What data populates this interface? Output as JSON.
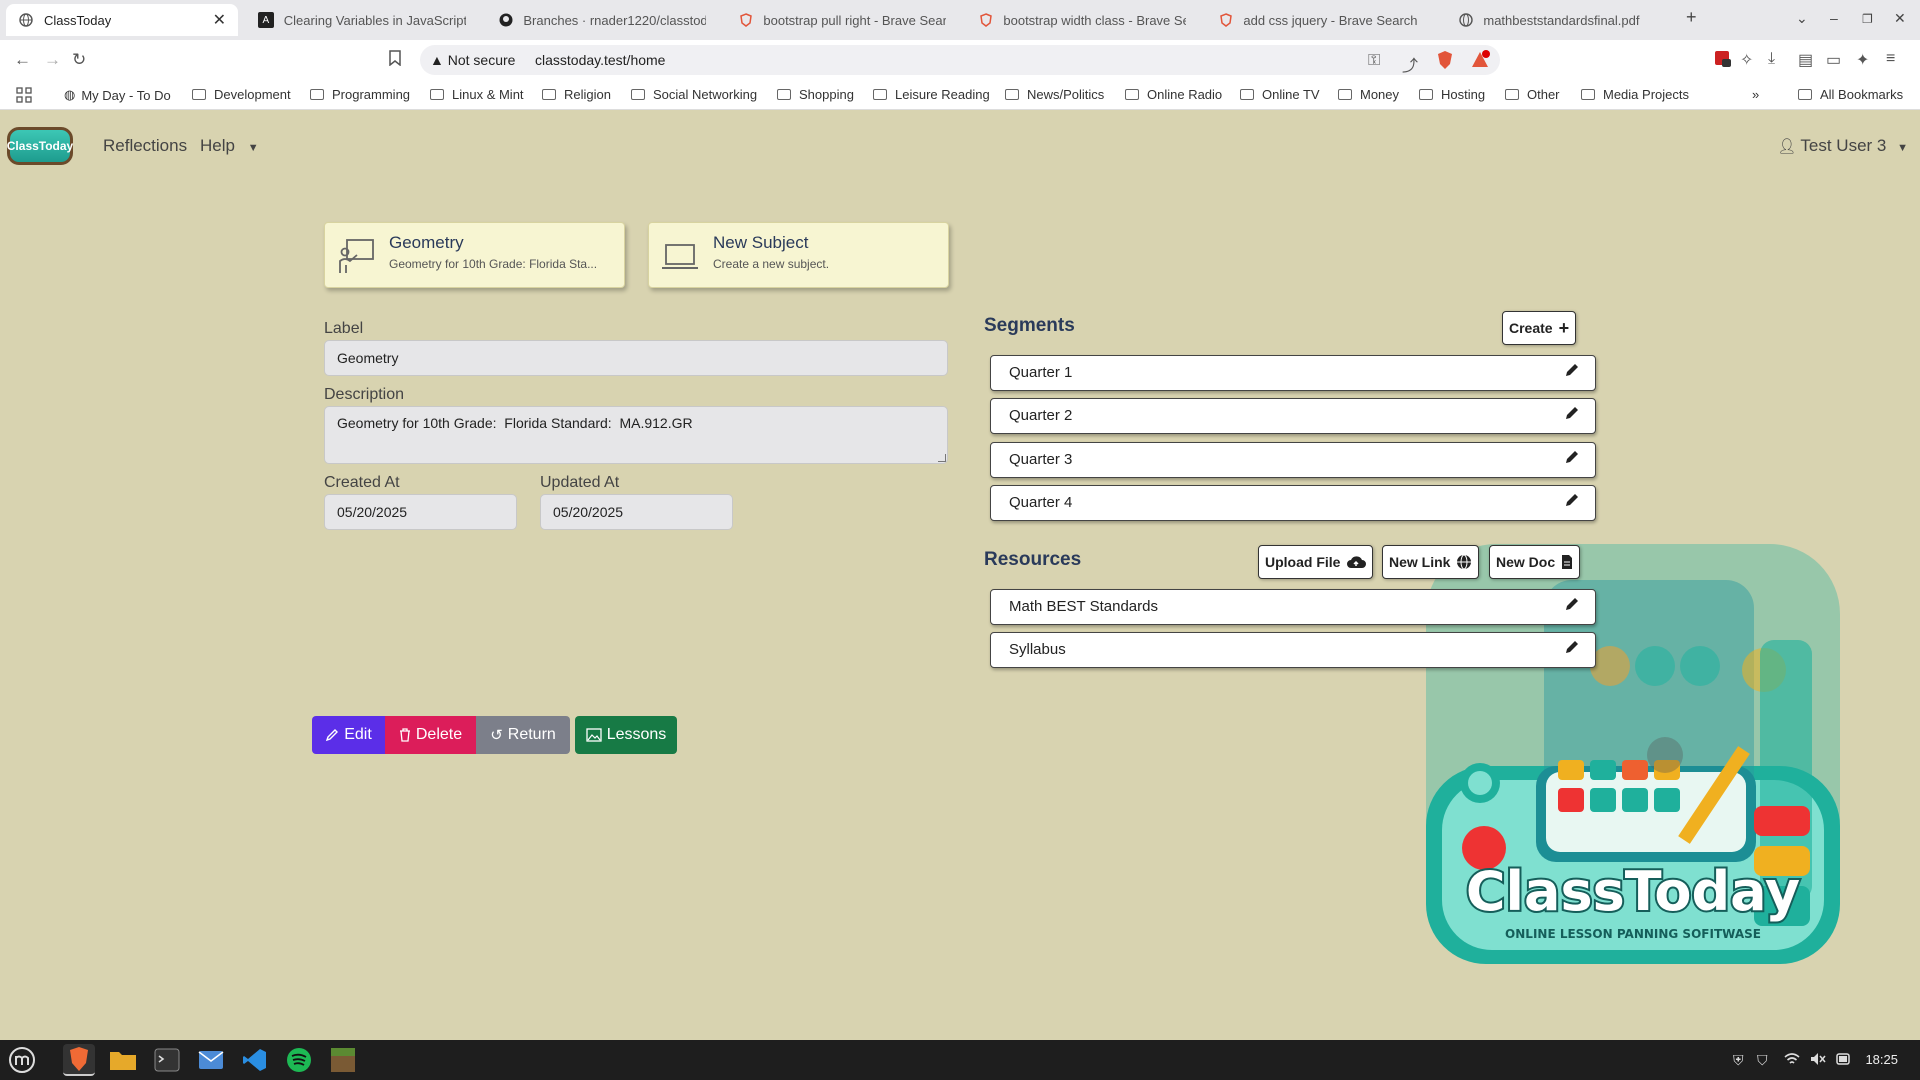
{
  "browser": {
    "tabs": [
      {
        "title": "ClassToday",
        "active": true
      },
      {
        "title": "Clearing Variables in JavaScript"
      },
      {
        "title": "Branches · rnader1220/classtoda"
      },
      {
        "title": "bootstrap pull right - Brave Sear"
      },
      {
        "title": "bootstrap width class - Brave Se"
      },
      {
        "title": "add css jquery - Brave Search"
      },
      {
        "title": "mathbeststandardsfinal.pdf"
      }
    ],
    "security_label": "Not secure",
    "url": "classtoday.test/home",
    "bookmarks": [
      "My Day - To Do",
      "Development",
      "Programming",
      "Linux & Mint",
      "Religion",
      "Social Networking",
      "Shopping",
      "Leisure Reading",
      "News/Politics",
      "Online Radio",
      "Online TV",
      "Money",
      "Hosting",
      "Other",
      "Media Projects"
    ],
    "all_bookmarks": "All Bookmarks"
  },
  "app": {
    "logo_text": "ClassToday",
    "nav": {
      "reflections": "Reflections",
      "help": "Help",
      "user": "Test User 3"
    },
    "subjects": [
      {
        "title": "Geometry",
        "desc": "Geometry for 10th Grade: Florida Sta..."
      },
      {
        "title": "New Subject",
        "desc": "Create a new subject."
      }
    ],
    "form": {
      "label_label": "Label",
      "label_value": "Geometry",
      "description_label": "Description",
      "description_value": "Geometry for 10th Grade:  Florida Standard:  MA.912.GR",
      "created_label": "Created At",
      "created_value": "05/20/2025",
      "updated_label": "Updated At",
      "updated_value": "05/20/2025"
    },
    "segments": {
      "title": "Segments",
      "create_label": "Create",
      "items": [
        "Quarter 1",
        "Quarter 2",
        "Quarter 3",
        "Quarter 4"
      ]
    },
    "resources": {
      "title": "Resources",
      "upload_label": "Upload File",
      "link_label": "New Link",
      "doc_label": "New Doc",
      "items": [
        "Math BEST Standards",
        "Syllabus"
      ]
    },
    "actions": {
      "edit": "Edit",
      "delete": "Delete",
      "return": "Return",
      "lessons": "Lessons"
    },
    "art": {
      "title": "ClassToday",
      "subtitle": "ONLINE LESSON PANNING SOFITWASE"
    }
  },
  "taskbar": {
    "clock": "18:25"
  },
  "colors": {
    "page_bg": "#d8d3b0",
    "edit": "#5b2ee8",
    "delete": "#dc1d5a",
    "return": "#7c7f8a",
    "lessons": "#177a45"
  }
}
